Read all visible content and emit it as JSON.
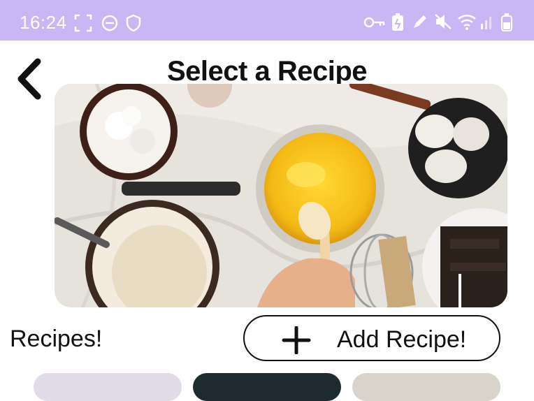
{
  "status_bar": {
    "time": "16:24",
    "icons": [
      "screenshot-icon",
      "dnd-icon",
      "shield-icon",
      "key-icon",
      "battery-saver-icon",
      "pen-icon",
      "mute-icon",
      "wifi-icon",
      "signal-icon",
      "battery-icon"
    ]
  },
  "header": {
    "title": "Select a Recipe",
    "back_icon": "chevron-left-icon"
  },
  "hero": {
    "image_description_name": "baking-ingredients-photo"
  },
  "recipes": {
    "label": "Recipes!",
    "add_button_label": "Add Recipe!",
    "add_icon": "plus-icon"
  },
  "colors": {
    "status_bar": "#c9b6f5",
    "background": "#ffffff",
    "text": "#111111"
  }
}
